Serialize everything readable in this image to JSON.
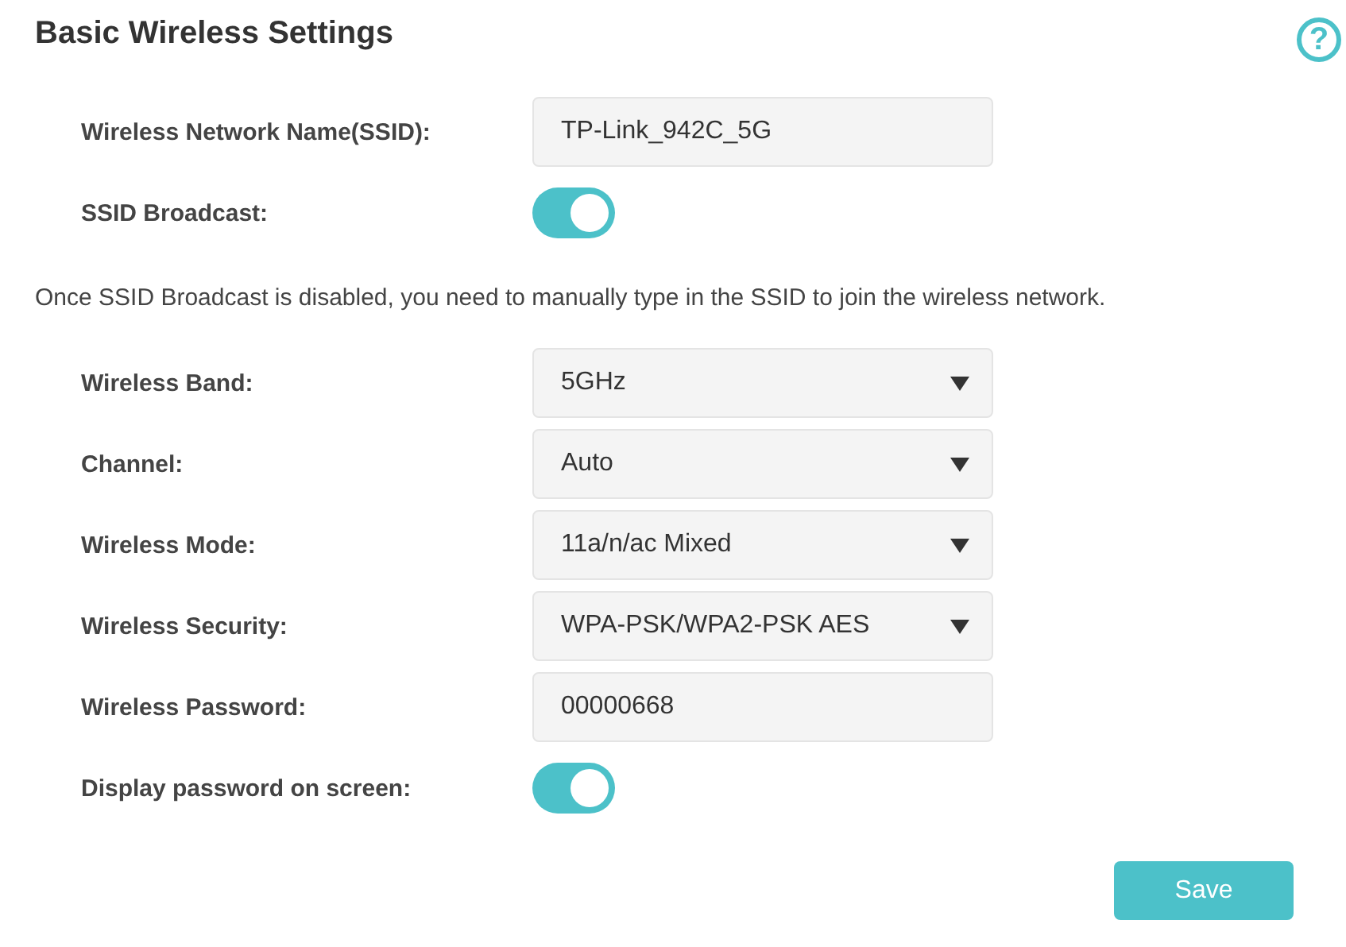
{
  "title": "Basic Wireless Settings",
  "help_icon": "?",
  "rows": [
    {
      "kind": "text",
      "label": "Wireless Network Name(SSID):",
      "value": "TP-Link_942C_5G"
    },
    {
      "kind": "toggle",
      "label": "SSID Broadcast:",
      "on": true
    },
    {
      "kind": "note",
      "text": "Once SSID Broadcast is disabled, you need to manually type in the SSID to join the wireless network."
    },
    {
      "kind": "select",
      "label": "Wireless Band:",
      "value": "5GHz"
    },
    {
      "kind": "select",
      "label": "Channel:",
      "value": "Auto"
    },
    {
      "kind": "select",
      "label": "Wireless Mode:",
      "value": "11a/n/ac Mixed"
    },
    {
      "kind": "select",
      "label": "Wireless Security:",
      "value": "WPA-PSK/WPA2-PSK AES"
    },
    {
      "kind": "text",
      "label": "Wireless Password:",
      "value": "00000668"
    },
    {
      "kind": "toggle",
      "label": "Display password on screen:",
      "on": true
    }
  ],
  "save_button": "Save"
}
